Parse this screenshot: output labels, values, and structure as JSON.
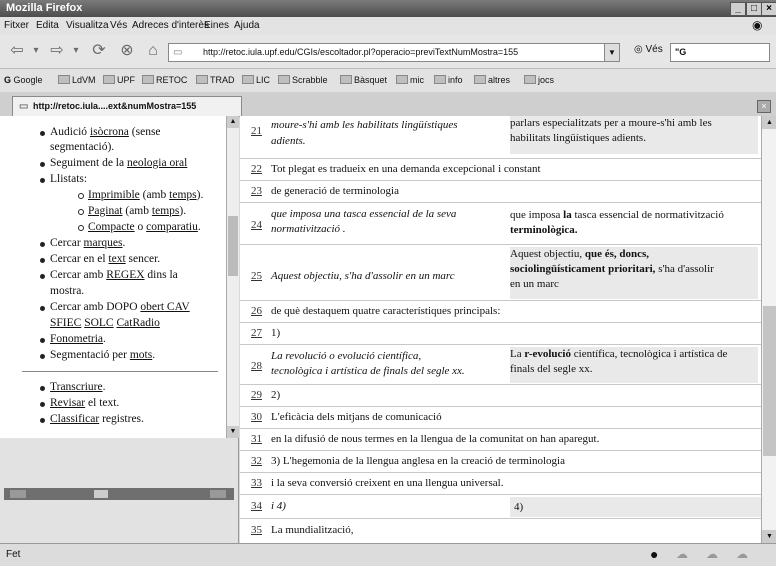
{
  "window": {
    "title": "Mozilla Firefox"
  },
  "menu": [
    "Fitxer",
    "Edita",
    "Visualitza",
    "Vés",
    "Adreces d'interès",
    "Eines",
    "Ajuda"
  ],
  "nav": {
    "url": "http://retoc.iula.upf.edu/CGIs/escoltador.pl?operacio=previTextNumMostra=155",
    "go_label": "Vés",
    "search_value": "\"G"
  },
  "bookmarks": [
    "Google",
    "LdVM",
    "UPF",
    "RETOC",
    "TRAD",
    "LIC",
    "Scrabble",
    "Bàsquet",
    "mic",
    "info",
    "altres",
    "jocs"
  ],
  "tab": {
    "label": "http://retoc.iula....ext&numMostra=155"
  },
  "sidebar": {
    "i0": {
      "a": "Audició ",
      "b": "isòcrona",
      "c": " (sense"
    },
    "i0b": "segmentació).",
    "i1": {
      "a": "Seguiment de la ",
      "b": "neologia oral"
    },
    "i2": "Llistats:",
    "i3": {
      "a": "Imprimible",
      "b": " (amb ",
      "c": "temps",
      "d": ")."
    },
    "i4": {
      "a": "Paginat",
      "b": " (amb ",
      "c": "temps",
      "d": ")."
    },
    "i5": {
      "a": "Compacte",
      "b": " o ",
      "c": "comparatiu",
      "d": "."
    },
    "i6": {
      "a": "Cercar ",
      "b": "marques",
      "c": "."
    },
    "i7": {
      "a": "Cercar en el ",
      "b": "text",
      "c": " sencer."
    },
    "i8": {
      "a": "Cercar amb ",
      "b": "REGEX",
      "c": " dins la"
    },
    "i8b": "mostra.",
    "i9": {
      "a": "Cercar amb DOPO ",
      "b": "obert",
      "c": " CAV"
    },
    "i9b": {
      "a": "SFIEC",
      "b": "SOLC",
      "c": "CatRadio"
    },
    "i10": {
      "a": "Fonometria",
      "b": "."
    },
    "i11": {
      "a": "Segmentació per ",
      "b": "mots",
      "c": "."
    },
    "i12": {
      "a": "Transcriure",
      "b": "."
    },
    "i13": {
      "a": "Revisar",
      "b": " el text."
    },
    "i14": {
      "a": "Classificar",
      "b": " registres."
    }
  },
  "rows": [
    {
      "n": "21",
      "l1": "moure-s'hi amb les habilitats lingüístiques",
      "l2": "adients.",
      "r1": "parlars especialitzats per a moure-s'hi amb les",
      "r2": "habilitats lingüístiques adients."
    },
    {
      "n": "22",
      "t": "Tot plegat es tradueix en una demanda excepcional i constant"
    },
    {
      "n": "23",
      "t": "de generació de terminologia"
    },
    {
      "n": "24",
      "l1": "que imposa una tasca essencial de la seva",
      "l2": "normativització .",
      "r1a": "que imposa ",
      "r1b": "la",
      "r1c": " tasca essencial de normativització",
      "r2": "terminològica."
    },
    {
      "n": "25",
      "l": "Aquest objectiu, s'ha d'assolir en un marc",
      "r1a": "Aquest objectiu, ",
      "r1b": "que és, doncs,",
      "r2a": "sociolingüísticament prioritari,",
      "r2b": " s'ha d'assolir",
      "r3": "en un marc"
    },
    {
      "n": "26",
      "t": "de què destaquem quatre característiques principals:"
    },
    {
      "n": "27",
      "t": "1)"
    },
    {
      "n": "28",
      "l1": "La revolució o evolució científica,",
      "l2": "tecnològica i artística de finals del segle xx.",
      "r1a": "La ",
      "r1b": "r-evolució",
      "r1c": " científica, tecnològica i artística de",
      "r2": "finals del segle xx."
    },
    {
      "n": "29",
      "t": "2)"
    },
    {
      "n": "30",
      "t": "L'eficàcia dels mitjans de comunicació"
    },
    {
      "n": "31",
      "t": "en la difusió de nous termes en la llengua de la comunitat on han aparegut."
    },
    {
      "n": "32",
      "t": "3) L'hegemonia de la llengua anglesa en la creació de terminologia"
    },
    {
      "n": "33",
      "t": "i la seva conversió creixent en una llengua universal."
    },
    {
      "n": "34",
      "l": "i 4)",
      "r": "4)"
    },
    {
      "n": "35",
      "t": "La mundialització,"
    }
  ],
  "status": {
    "text": "Fet"
  }
}
